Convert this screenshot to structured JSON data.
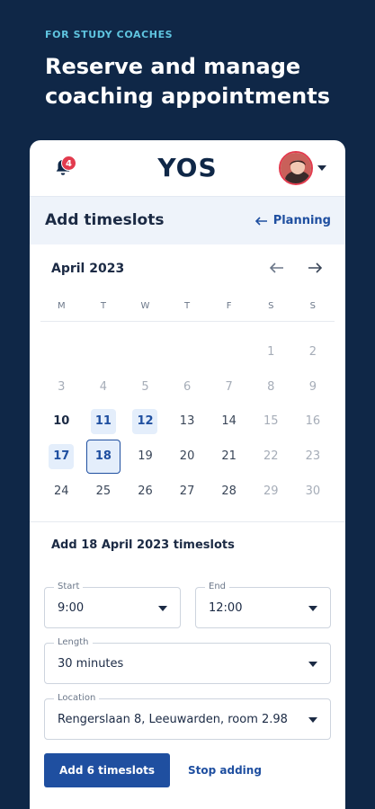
{
  "promo": {
    "kicker": "FOR STUDY COACHES",
    "title": "Reserve and manage coaching appointments"
  },
  "topbar": {
    "notification_count": "4",
    "logo_text": "YOS",
    "icons": [
      "bell-icon",
      "avatar",
      "chevron-down-icon"
    ]
  },
  "header": {
    "title": "Add timeslots",
    "planning_link": "Planning"
  },
  "calendar": {
    "month": "April 2023",
    "weekdays": [
      "M",
      "T",
      "W",
      "T",
      "F",
      "S",
      "S"
    ],
    "weeks": [
      [
        "",
        "",
        "",
        "",
        "",
        "1",
        "2"
      ],
      [
        "3",
        "4",
        "5",
        "6",
        "7",
        "8",
        "9"
      ],
      [
        "10",
        "11",
        "12",
        "13",
        "14",
        "15",
        "16"
      ],
      [
        "17",
        "18",
        "19",
        "20",
        "21",
        "22",
        "23"
      ],
      [
        "24",
        "25",
        "26",
        "27",
        "28",
        "29",
        "30"
      ]
    ],
    "selected_day": "18",
    "highlighted_days": [
      "11",
      "12",
      "17"
    ]
  },
  "form": {
    "section_title": "Add 18 April 2023 timeslots",
    "start": {
      "label": "Start",
      "value": "9:00"
    },
    "end": {
      "label": "End",
      "value": "12:00"
    },
    "length": {
      "label": "Length",
      "value": "30 minutes"
    },
    "location": {
      "label": "Location",
      "value": "Rengerslaan 8, Leeuwarden, room 2.98"
    },
    "submit_label": "Add 6 timeslots",
    "cancel_label": "Stop adding"
  },
  "colors": {
    "background": "#0f2747",
    "accent": "#1f4fa0",
    "kicker": "#5fc4df",
    "badge": "#e23b4e"
  }
}
